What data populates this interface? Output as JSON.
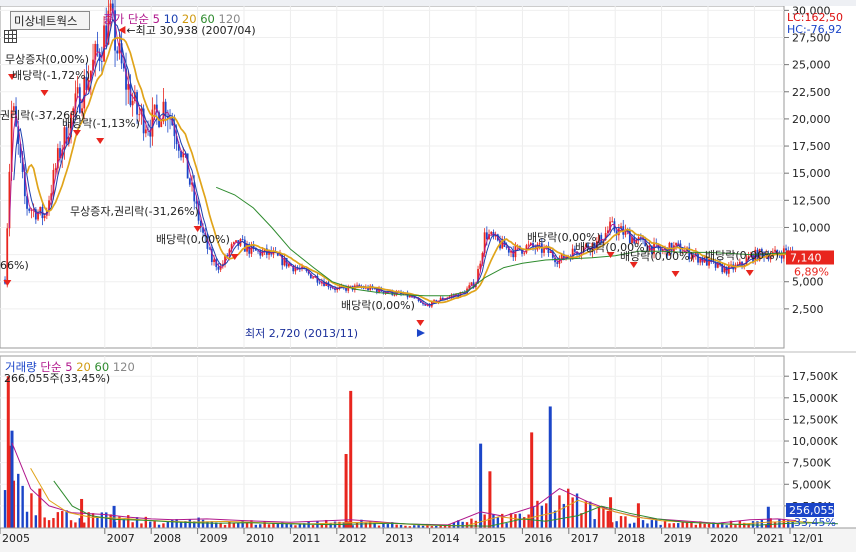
{
  "header": {
    "stock_name": "미상네트웍스",
    "ma_label": "종가 단순",
    "ma_periods": [
      "5",
      "10",
      "20",
      "60",
      "120"
    ],
    "lc_label": "LC:162,50",
    "hc_label": "HC:-76,92"
  },
  "volume_header": {
    "title": "거래량",
    "ma_label": "단순",
    "ma_periods": [
      "5",
      "20",
      "60",
      "120"
    ]
  },
  "colors": {
    "up": "#e8251e",
    "down": "#1b45c8",
    "ma5": "#b0178c",
    "ma10": "#1b3fb0",
    "ma20": "#e0a41a",
    "ma60": "#2e8b2e",
    "ma120": "#888888",
    "price_badge": "#e8251e",
    "volume_badge": "#1b45c8"
  },
  "chart_data": [
    {
      "type": "candlestick",
      "name": "price",
      "x_labels": [
        "2005",
        "2007",
        "2008",
        "2009",
        "2010",
        "2011",
        "2012",
        "2013",
        "2014",
        "2015",
        "2016",
        "2017",
        "2018",
        "2019",
        "2020",
        "2021",
        "12/01"
      ],
      "y_ticks": [
        "2,500",
        "5,000",
        "7,500",
        "10,000",
        "12,500",
        "15,000",
        "17,500",
        "20,000",
        "22,500",
        "25,000",
        "27,500",
        "30,000"
      ],
      "y_tick_values": [
        2500,
        5000,
        7500,
        10000,
        12500,
        15000,
        17500,
        20000,
        22500,
        25000,
        27500,
        30000
      ],
      "ylim": [
        0,
        32300
      ],
      "current_price": "7,140",
      "current_price_value": 7140,
      "change_pct": "6,89%",
      "high_annotation": "최고 30,938 (2007/04)",
      "high_value": 30938,
      "low_annotation": "최저 2,720 (2013/11)",
      "low_value": 2720,
      "annotations": [
        "무상증자(0,00%)",
        "배당락(-1,72%)",
        "권리락(-37,26%)",
        "배당락(-1,13%)",
        "무상증자,권리락(-31,26%)",
        "배당락(0,00%)",
        "배당락(0,00%)",
        "배당락(0,00%)",
        "배당락(0,00%)",
        "배당락(0,00%)",
        "배당락(0,00%)",
        "66%)"
      ],
      "approx_close": [
        [
          2004.85,
          5200
        ],
        [
          2005.0,
          21500
        ],
        [
          2005.3,
          12000
        ],
        [
          2005.7,
          11000
        ],
        [
          2006.0,
          16500
        ],
        [
          2006.3,
          20500
        ],
        [
          2006.6,
          23500
        ],
        [
          2006.9,
          26500
        ],
        [
          2007.1,
          29500
        ],
        [
          2007.4,
          24000
        ],
        [
          2007.7,
          20500
        ],
        [
          2008.0,
          19500
        ],
        [
          2008.3,
          21500
        ],
        [
          2008.6,
          18000
        ],
        [
          2008.9,
          13000
        ],
        [
          2009.1,
          9500
        ],
        [
          2009.3,
          7000
        ],
        [
          2009.5,
          6300
        ],
        [
          2009.7,
          8000
        ],
        [
          2009.9,
          8500
        ],
        [
          2010.2,
          7800
        ],
        [
          2010.6,
          7500
        ],
        [
          2011.0,
          6500
        ],
        [
          2011.5,
          5500
        ],
        [
          2012.0,
          4300
        ],
        [
          2012.5,
          4500
        ],
        [
          2012.8,
          4300
        ],
        [
          2013.2,
          4000
        ],
        [
          2013.6,
          3600
        ],
        [
          2013.9,
          2720
        ],
        [
          2014.3,
          3500
        ],
        [
          2014.7,
          3900
        ],
        [
          2015.0,
          5000
        ],
        [
          2015.2,
          9500
        ],
        [
          2015.5,
          8500
        ],
        [
          2015.8,
          7800
        ],
        [
          2016.1,
          8200
        ],
        [
          2016.5,
          7900
        ],
        [
          2016.8,
          7000
        ],
        [
          2017.2,
          8000
        ],
        [
          2017.6,
          8500
        ],
        [
          2017.9,
          10000
        ],
        [
          2018.2,
          9500
        ],
        [
          2018.4,
          9000
        ],
        [
          2018.7,
          8300
        ],
        [
          2019.0,
          7800
        ],
        [
          2019.3,
          8200
        ],
        [
          2019.6,
          7600
        ],
        [
          2019.9,
          7000
        ],
        [
          2020.1,
          6500
        ],
        [
          2020.4,
          6100
        ],
        [
          2020.7,
          6500
        ],
        [
          2020.9,
          7300
        ],
        [
          2021.2,
          7600
        ],
        [
          2021.5,
          7500
        ],
        [
          2021.7,
          7900
        ],
        [
          2021.9,
          7140
        ]
      ],
      "approx_ma120": [
        [
          2009.4,
          13700
        ],
        [
          2009.8,
          13000
        ],
        [
          2010.2,
          11800
        ],
        [
          2010.6,
          10000
        ],
        [
          2011.0,
          8000
        ],
        [
          2011.5,
          6300
        ],
        [
          2011.9,
          5000
        ],
        [
          2012.4,
          4300
        ],
        [
          2012.9,
          4000
        ],
        [
          2013.4,
          3800
        ],
        [
          2013.9,
          3700
        ],
        [
          2014.4,
          3700
        ],
        [
          2014.8,
          4100
        ],
        [
          2015.2,
          5400
        ],
        [
          2015.6,
          6300
        ],
        [
          2016.0,
          6700
        ],
        [
          2016.5,
          7000
        ],
        [
          2017.0,
          7100
        ],
        [
          2017.5,
          7200
        ],
        [
          2018.0,
          7400
        ],
        [
          2018.5,
          7800
        ],
        [
          2019.0,
          7800
        ],
        [
          2019.5,
          7700
        ],
        [
          2020.0,
          7700
        ],
        [
          2020.5,
          7600
        ],
        [
          2020.9,
          7500
        ],
        [
          2021.4,
          7600
        ],
        [
          2021.9,
          7700
        ]
      ]
    },
    {
      "type": "bar",
      "name": "volume",
      "y_ticks": [
        "2,500K",
        "5,000K",
        "7,500K",
        "10,000K",
        "12,500K",
        "15,000K",
        "17,500K"
      ],
      "y_tick_values": [
        2500,
        5000,
        7500,
        10000,
        12500,
        15000,
        17500
      ],
      "ylim": [
        0,
        18800
      ],
      "unit": "K",
      "max_annotation": "266,055주(33,45%)",
      "current_volume": "256,055",
      "current_pct": "33,45%",
      "spikes": [
        [
          2004.92,
          17500
        ],
        [
          2005.0,
          11200
        ],
        [
          2005.6,
          4500
        ],
        [
          2006.5,
          3300
        ],
        [
          2007.2,
          2500
        ],
        [
          2012.3,
          15800
        ],
        [
          2012.2,
          8500
        ],
        [
          2015.1,
          9700
        ],
        [
          2015.3,
          6500
        ],
        [
          2016.2,
          11000
        ],
        [
          2016.6,
          14000
        ],
        [
          2017.9,
          3500
        ],
        [
          2018.5,
          2800
        ],
        [
          2021.3,
          2400
        ]
      ],
      "approx_ma20": [
        [
          2005.0,
          9800
        ],
        [
          2005.4,
          4500
        ],
        [
          2005.8,
          2500
        ],
        [
          2006.3,
          1700
        ],
        [
          2007.0,
          1500
        ],
        [
          2007.5,
          1200
        ],
        [
          2008.0,
          1000
        ],
        [
          2008.5,
          900
        ],
        [
          2009.2,
          1000
        ],
        [
          2010.0,
          800
        ],
        [
          2011.0,
          600
        ],
        [
          2012.3,
          900
        ],
        [
          2012.8,
          700
        ],
        [
          2013.5,
          400
        ],
        [
          2014.4,
          300
        ],
        [
          2015.1,
          1800
        ],
        [
          2015.6,
          1300
        ],
        [
          2016.3,
          2500
        ],
        [
          2016.8,
          4500
        ],
        [
          2017.4,
          3000
        ],
        [
          2018.0,
          1800
        ],
        [
          2018.6,
          1100
        ],
        [
          2019.4,
          800
        ],
        [
          2020.2,
          500
        ],
        [
          2020.9,
          900
        ],
        [
          2021.5,
          1000
        ],
        [
          2021.9,
          800
        ]
      ]
    }
  ]
}
